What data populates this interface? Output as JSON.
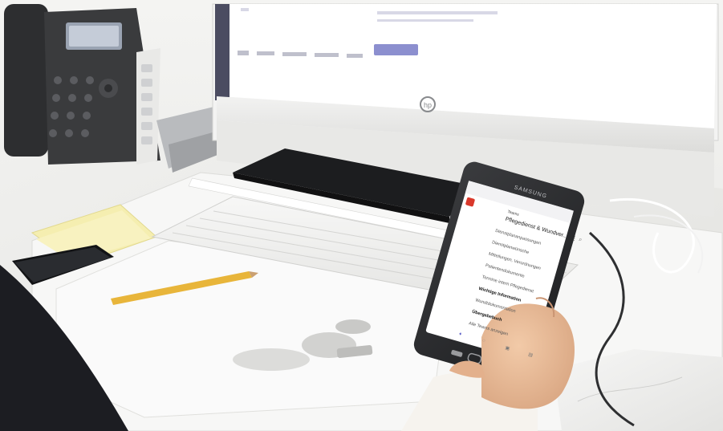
{
  "monitor": {
    "brand_logo": "hp-logo",
    "taskbar_icons": [
      "windows-icon",
      "search-icon",
      "folder-icon",
      "browser-icon",
      "mail-icon",
      "app-icon"
    ],
    "accent_button_color": "#8c8fcf"
  },
  "phone": {
    "brand": "SAMSUNG",
    "app": {
      "header_label": "Teams",
      "channel_title": "Pflegedienst & Wundver...",
      "accent_color": "#d9382b",
      "menu_items": [
        {
          "label": "Dienstplananpassungen",
          "bold": false
        },
        {
          "label": "Dienstplanwünsche",
          "bold": false
        },
        {
          "label": "Mitteilungen, Verordnungen",
          "bold": false
        },
        {
          "label": "Patientendokumente",
          "bold": false
        },
        {
          "label": "Termine intern Pflegedienst",
          "bold": false
        },
        {
          "label": "Wichtige Information",
          "bold": true
        },
        {
          "label": "Wundtdokumentation",
          "bold": false
        },
        {
          "label": "Übergabebuch",
          "bold": true
        },
        {
          "label": "Alle Teams anzeigen",
          "bold": false
        }
      ],
      "bottom_nav_icons": [
        "activity-icon",
        "chat-icon",
        "teams-icon",
        "calendar-icon"
      ]
    }
  },
  "palette": {
    "wall": "#ececea",
    "desk": "#f4f4f2",
    "phone_body": "#2a2b2d",
    "sticky_note": "#f5eeb0",
    "pencil": "#e8b53a",
    "skin": "#e8bc98",
    "sleeve": "#f6f3ee"
  }
}
